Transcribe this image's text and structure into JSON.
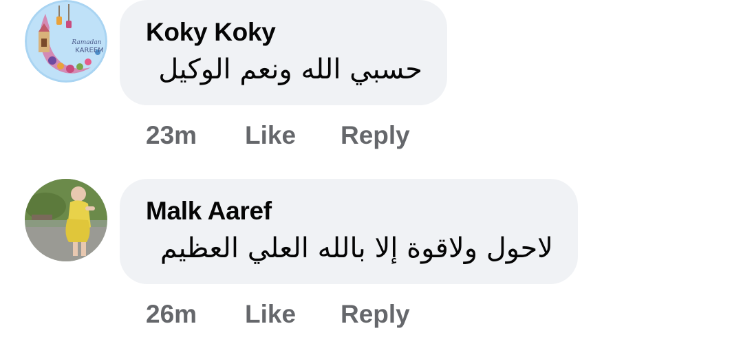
{
  "comments": [
    {
      "author": "Koky Koky",
      "text": "حسبي الله ونعم الوكيل",
      "time": "23m",
      "like_label": "Like",
      "reply_label": "Reply",
      "avatar_icon": "ramadan-kareem-avatar-icon",
      "avatar_caption_1": "Ramadan",
      "avatar_caption_2": "KAREEM"
    },
    {
      "author": "Malk Aaref",
      "text": "لاحول ولاقوة إلا بالله العلي العظيم",
      "time": "26m",
      "like_label": "Like",
      "reply_label": "Reply",
      "avatar_icon": "child-photo-avatar-icon"
    }
  ],
  "colors": {
    "bubble_bg": "#f0f2f5",
    "author_text": "#050505",
    "action_text": "#65676b"
  }
}
